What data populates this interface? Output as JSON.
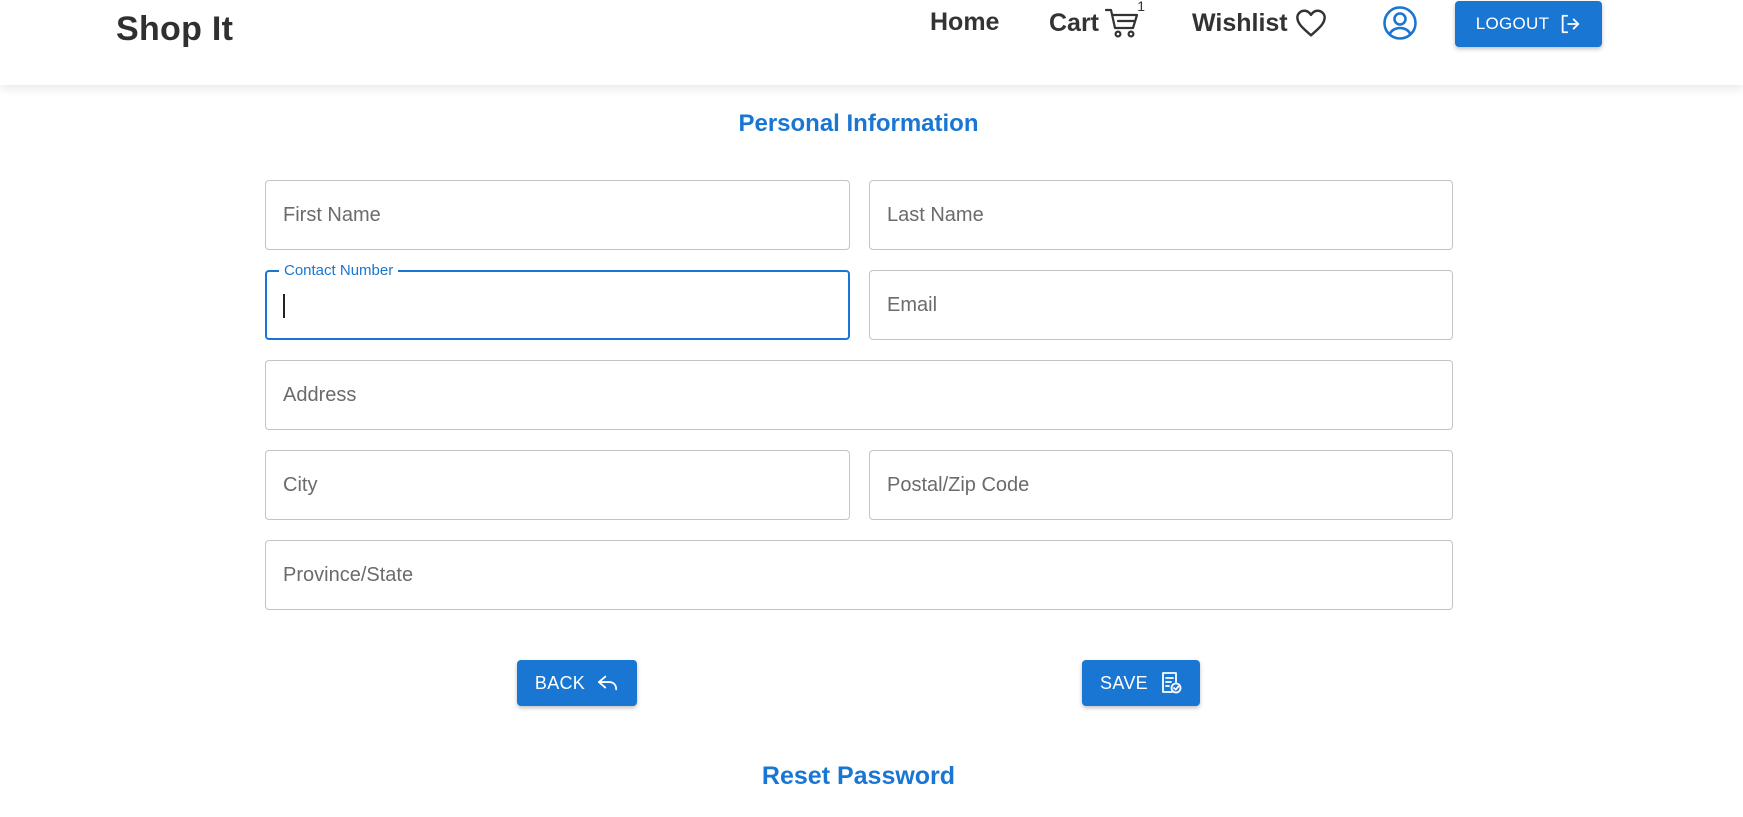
{
  "header": {
    "brand": "Shop It",
    "nav": {
      "home": "Home",
      "cart": "Cart",
      "cart_count": "1",
      "wishlist": "Wishlist"
    },
    "profile_icon": "account-circle-icon",
    "logout_label": "LOGOUT",
    "logout_icon": "logout-icon"
  },
  "form": {
    "title": "Personal Information",
    "fields": {
      "first_name": {
        "placeholder": "First Name",
        "value": ""
      },
      "last_name": {
        "placeholder": "Last Name",
        "value": ""
      },
      "contact_number": {
        "label": "Contact Number",
        "value": ""
      },
      "email": {
        "placeholder": "Email",
        "value": ""
      },
      "address": {
        "placeholder": "Address",
        "value": ""
      },
      "city": {
        "placeholder": "City",
        "value": ""
      },
      "postal_code": {
        "placeholder": "Postal/Zip Code",
        "value": ""
      },
      "province": {
        "placeholder": "Province/State",
        "value": ""
      }
    },
    "back_label": "BACK",
    "back_icon": "reply-icon",
    "save_label": "SAVE",
    "save_icon": "save-document-icon"
  },
  "reset_password": "Reset Password",
  "colors": {
    "primary": "#1976d2",
    "text": "#333333",
    "border": "#c4c4c4"
  }
}
